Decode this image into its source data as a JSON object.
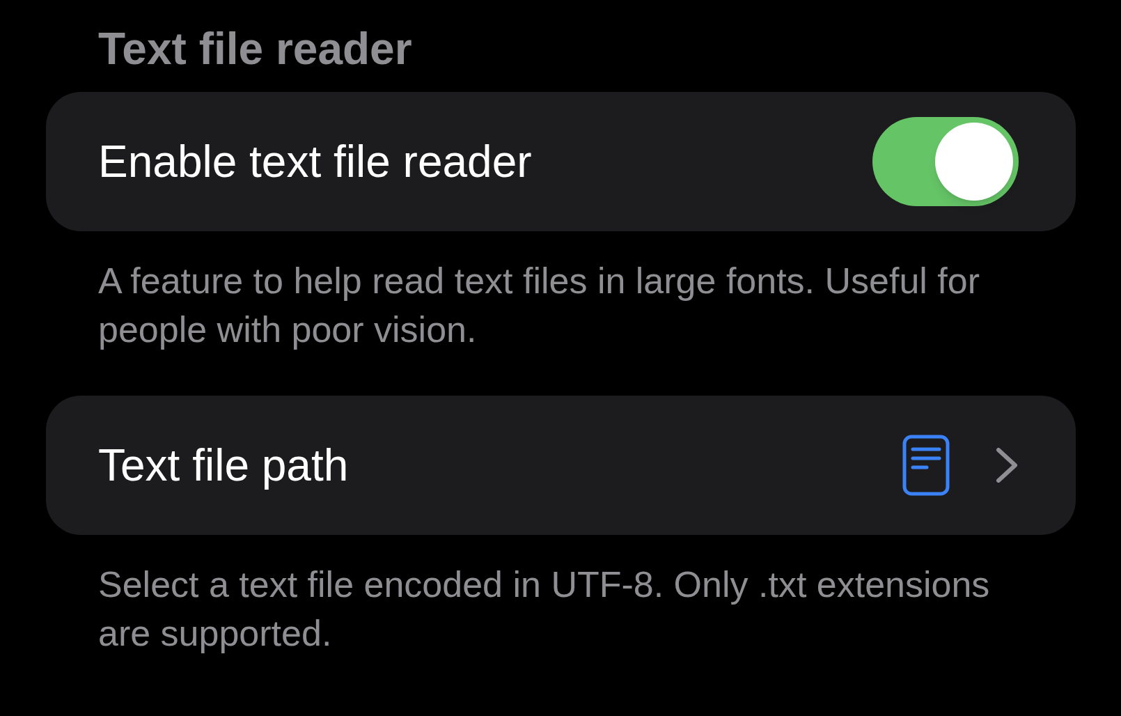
{
  "section_title": "Text file reader",
  "settings": [
    {
      "kind": "toggle",
      "label": "Enable text file reader",
      "on": true,
      "footer": "A feature to help read text files in large fonts. Useful for people with poor vision."
    },
    {
      "kind": "link",
      "label": "Text file path",
      "footer": "Select a text file encoded in UTF-8. Only .txt extensions are supported."
    }
  ]
}
